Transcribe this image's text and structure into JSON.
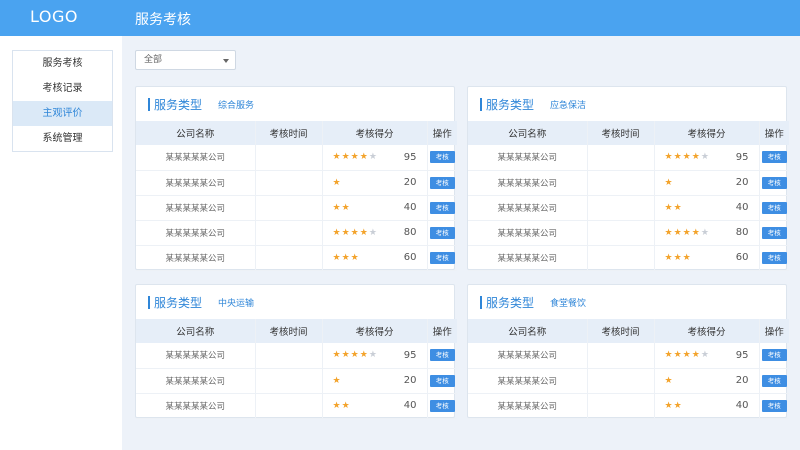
{
  "header": {
    "logo": "LOGO",
    "title": "服务考核"
  },
  "sidebar": {
    "items": [
      {
        "label": "服务考核",
        "active": false
      },
      {
        "label": "考核记录",
        "active": false
      },
      {
        "label": "主观评价",
        "active": true
      },
      {
        "label": "系统管理",
        "active": false
      }
    ]
  },
  "filter": {
    "value": "全部"
  },
  "table_headers": [
    "公司名称",
    "考核时间",
    "考核得分",
    "操作"
  ],
  "cards": [
    {
      "label": "服务类型",
      "type": "综合服务",
      "rows": [
        {
          "company": "某某某某某公司",
          "time": "",
          "stars": 4,
          "score": "95",
          "action": "考核"
        },
        {
          "company": "某某某某某公司",
          "time": "",
          "stars": 1,
          "score": "20",
          "action": "考核"
        },
        {
          "company": "某某某某某公司",
          "time": "",
          "stars": 2,
          "score": "40",
          "action": "考核"
        },
        {
          "company": "某某某某某公司",
          "time": "",
          "stars": 4,
          "score": "80",
          "action": "考核"
        },
        {
          "company": "某某某某某公司",
          "time": "",
          "stars": 3,
          "score": "60",
          "action": "考核"
        }
      ]
    },
    {
      "label": "服务类型",
      "type": "应急保洁",
      "rows": [
        {
          "company": "某某某某某公司",
          "time": "",
          "stars": 4,
          "score": "95",
          "action": "考核"
        },
        {
          "company": "某某某某某公司",
          "time": "",
          "stars": 1,
          "score": "20",
          "action": "考核"
        },
        {
          "company": "某某某某某公司",
          "time": "",
          "stars": 2,
          "score": "40",
          "action": "考核"
        },
        {
          "company": "某某某某某公司",
          "time": "",
          "stars": 4,
          "score": "80",
          "action": "考核"
        },
        {
          "company": "某某某某某公司",
          "time": "",
          "stars": 3,
          "score": "60",
          "action": "考核"
        }
      ]
    },
    {
      "label": "服务类型",
      "type": "中央运输",
      "rows": [
        {
          "company": "某某某某某公司",
          "time": "",
          "stars": 4,
          "score": "95",
          "action": "考核"
        },
        {
          "company": "某某某某某公司",
          "time": "",
          "stars": 1,
          "score": "20",
          "action": "考核"
        },
        {
          "company": "某某某某某公司",
          "time": "",
          "stars": 2,
          "score": "40",
          "action": "考核"
        }
      ]
    },
    {
      "label": "服务类型",
      "type": "食堂餐饮",
      "rows": [
        {
          "company": "某某某某某公司",
          "time": "",
          "stars": 4,
          "score": "95",
          "action": "考核"
        },
        {
          "company": "某某某某某公司",
          "time": "",
          "stars": 1,
          "score": "20",
          "action": "考核"
        },
        {
          "company": "某某某某某公司",
          "time": "",
          "stars": 2,
          "score": "40",
          "action": "考核"
        }
      ]
    }
  ],
  "colors": {
    "header": "#4aa3f0",
    "accent": "#2f86d8",
    "star": "#f3a32b",
    "button": "#3e8ee3"
  }
}
